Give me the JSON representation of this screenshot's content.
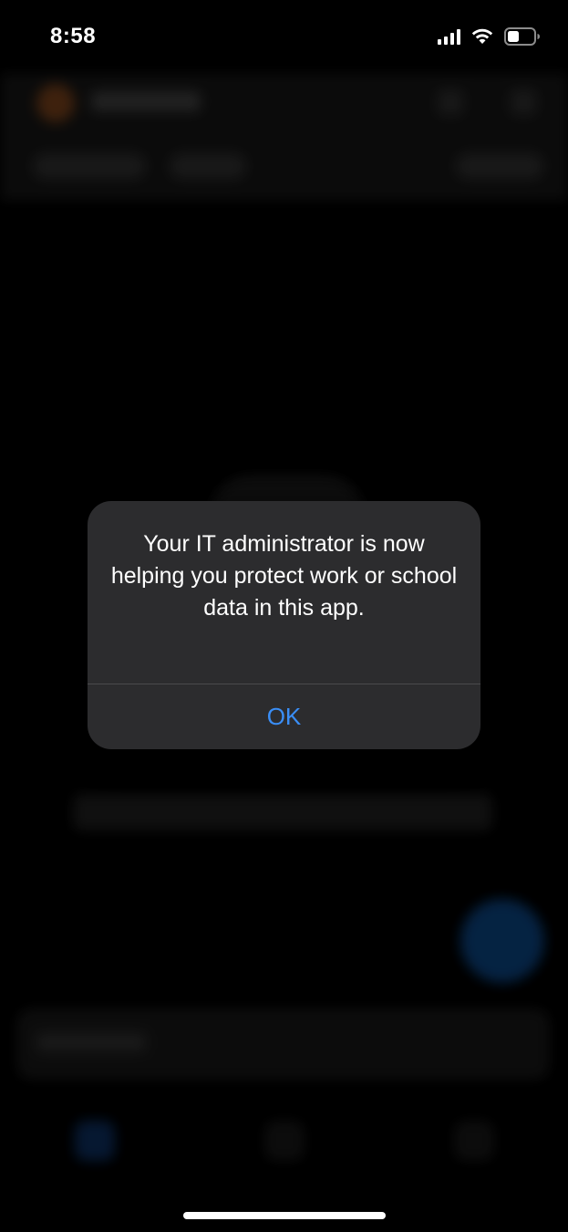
{
  "status_bar": {
    "time": "8:58",
    "icons": [
      "cellular-signal-icon",
      "wifi-icon",
      "battery-icon"
    ]
  },
  "alert": {
    "message": "Your IT administrator is now helping you protect work or school data in this app.",
    "ok_label": "OK",
    "ok_color": "#3a8ef6",
    "background": "#2c2c2e"
  },
  "background_app": {
    "accent_color": "#0b3c72",
    "avatar_color": "#6b3a18"
  }
}
